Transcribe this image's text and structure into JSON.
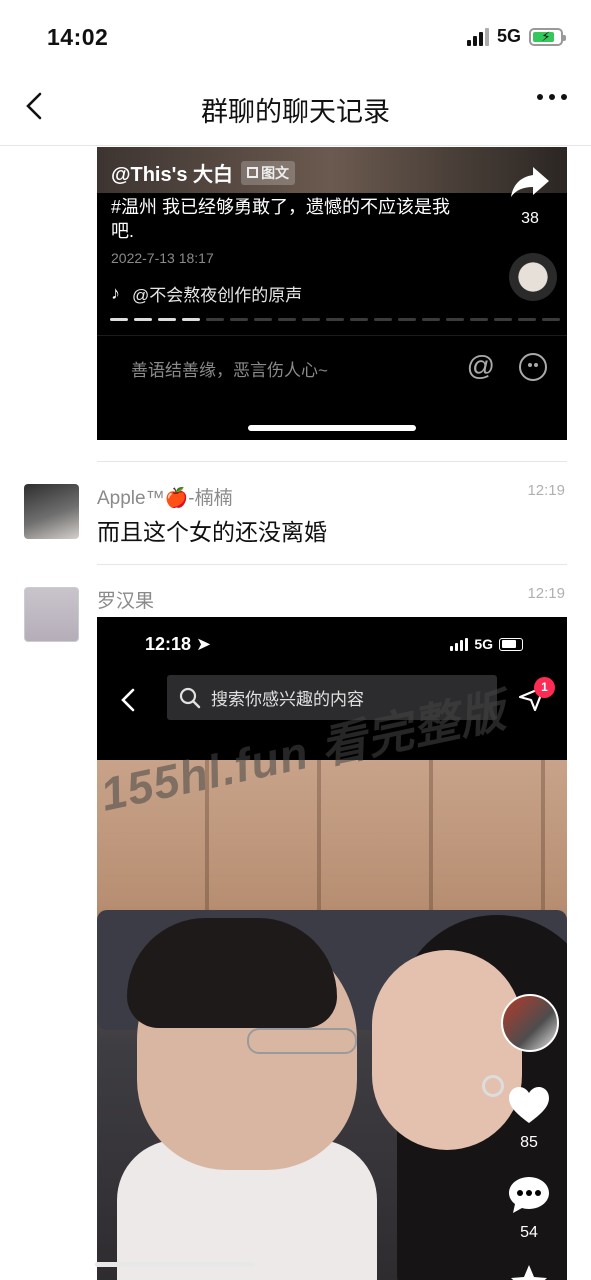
{
  "status_bar": {
    "time": "14:02",
    "network": "5G"
  },
  "nav": {
    "title": "群聊的聊天记录"
  },
  "card1": {
    "author": "@This's 大白",
    "tag": "图文",
    "description": "#温州  我已经够勇敢了，遗憾的不应该是我吧.",
    "date": "2022-7-13 18:17",
    "music": "@不会熬夜创作的原声",
    "share_count": "38",
    "comment_placeholder": "善语结善缘，恶言伤人心~",
    "at_symbol": "@"
  },
  "messages": [
    {
      "sender": "Apple™🍎-楠楠",
      "time": "12:19",
      "text": "而且这个女的还没离婚"
    },
    {
      "sender": "罗汉果",
      "time": "12:19"
    }
  ],
  "card2": {
    "time": "12:18",
    "network": "5G",
    "search_placeholder": "搜索你感兴趣的内容",
    "badge_count": "1",
    "like_count": "85",
    "comment_count": "54"
  },
  "watermark": "155hl.fun 看完整版",
  "colors": {
    "badge": "#fe2c55",
    "charging": "#34c759"
  },
  "icons": [
    "back-icon",
    "more-icon",
    "share-icon",
    "tiktok-icon",
    "at-icon",
    "emoji-icon",
    "search-icon",
    "send-icon",
    "heart-icon",
    "comment-icon",
    "star-icon"
  ]
}
